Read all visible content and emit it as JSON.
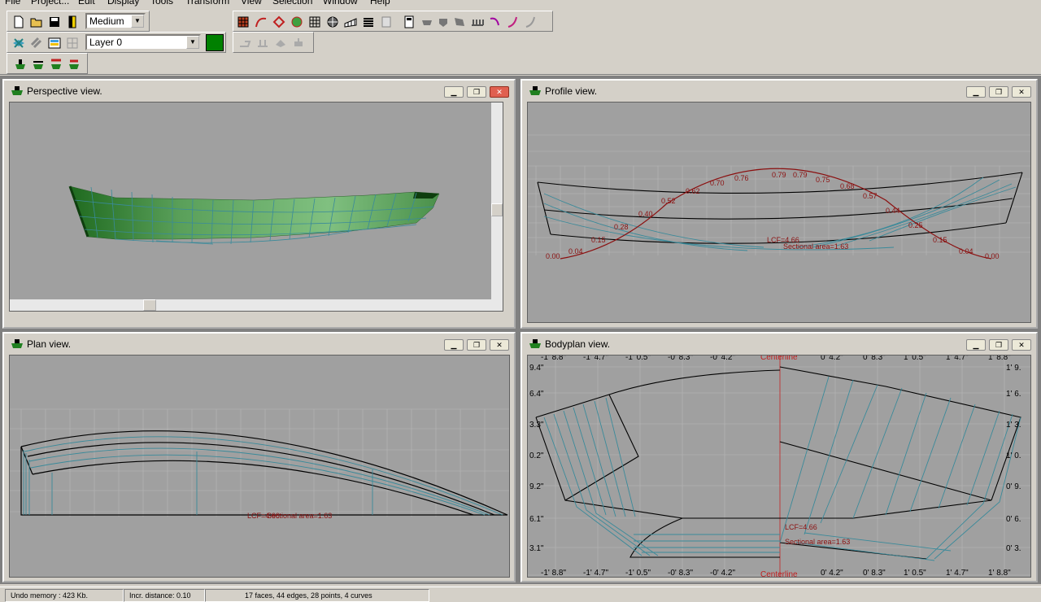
{
  "menu": [
    "File",
    "Project...",
    "Edit",
    "Display",
    "Tools",
    "Transform",
    "View",
    "Selection",
    "Window",
    "Help"
  ],
  "toolbar": {
    "precision_value": "Medium",
    "layer_value": "Layer 0",
    "layer_color": "#008000"
  },
  "windows": {
    "perspective": {
      "title": "Perspective view."
    },
    "profile": {
      "title": "Profile view.",
      "curve_labels": [
        "0.00",
        "0.04",
        "0.15",
        "0.28",
        "0.40",
        "0.52",
        "0.62",
        "0.70",
        "0.76",
        "0.79",
        "0.79",
        "0.75",
        "0.68",
        "0.57",
        "0.44",
        "0.25",
        "0.15",
        "0.04",
        "0.00"
      ],
      "lcf": "LCF=4.66",
      "area": "Sectional area=1.63"
    },
    "plan": {
      "title": "Plan view.",
      "lcf": "LCF=4.66",
      "area": "Sectional area=1.63"
    },
    "bodyplan": {
      "title": "Bodyplan view.",
      "centerline": "Centerline",
      "top_labels": [
        "-1' 8.8\"",
        "-1' 4.7\"",
        "-1' 0.5\"",
        "-0' 8.3\"",
        "-0' 4.2\"",
        "0' 4.2\"",
        "0' 8.3\"",
        "1' 0.5\"",
        "1' 4.7\"",
        "1' 8.8\""
      ],
      "left_labels": [
        "9.4\"",
        "6.4\"",
        "3.3\"",
        "0.2\"",
        "9.2\"",
        "6.1\"",
        "3.1\""
      ],
      "right_labels": [
        "1' 9.",
        "1' 6.",
        "1' 3.",
        "1' 0.",
        "0' 9.",
        "0' 6.",
        "0' 3."
      ],
      "lcf": "LCF=4.66",
      "area": "Sectional area=1.63"
    }
  },
  "status": {
    "undo": "Undo memory : 423 Kb.",
    "incr": "Incr. distance: 0.10",
    "counts": "17 faces, 44 edges, 28 points, 4 curves"
  }
}
